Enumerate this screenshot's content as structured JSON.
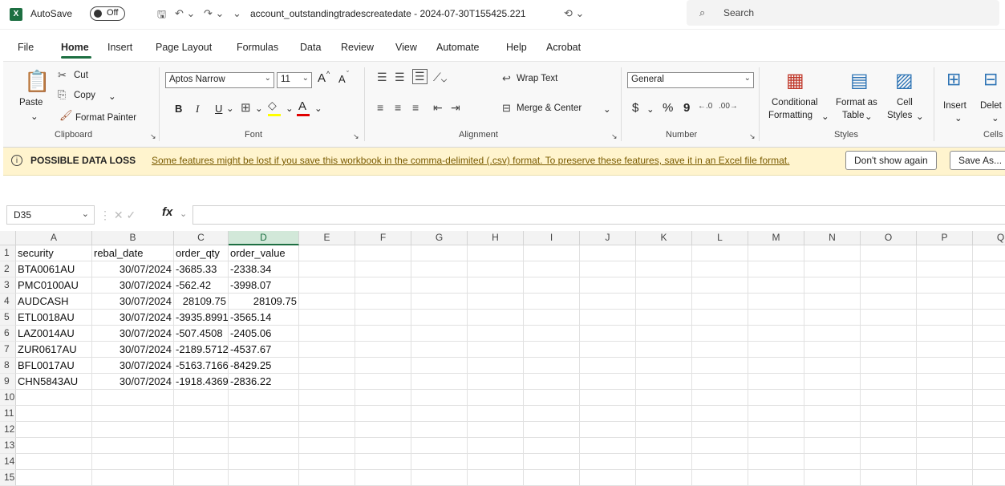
{
  "titlebar": {
    "app_logo": "X",
    "autosave_label": "AutoSave",
    "toggle_state": "Off",
    "filename": "account_outstandingtradescreatedate - 2024-07-30T155425.221",
    "search_placeholder": "Search"
  },
  "tabs": [
    "File",
    "Home",
    "Insert",
    "Page Layout",
    "Formulas",
    "Data",
    "Review",
    "View",
    "Automate",
    "Help",
    "Acrobat"
  ],
  "active_tab": "Home",
  "ribbon": {
    "clipboard": {
      "paste": "Paste",
      "cut": "Cut",
      "copy": "Copy",
      "format_painter": "Format Painter",
      "group": "Clipboard"
    },
    "font": {
      "name": "Aptos Narrow",
      "size": "11",
      "bold": "B",
      "italic": "I",
      "underline": "U",
      "group": "Font",
      "grow": "A",
      "shrink": "A",
      "fill": "A"
    },
    "alignment": {
      "wrap": "Wrap Text",
      "merge": "Merge & Center",
      "group": "Alignment"
    },
    "number": {
      "format": "General",
      "currency": "$",
      "percent": "%",
      "comma": "9",
      "group": "Number"
    },
    "styles": {
      "conditional_1": "Conditional",
      "conditional_2": "Formatting",
      "format_as_1": "Format as",
      "format_as_2": "Table",
      "cell_1": "Cell",
      "cell_2": "Styles",
      "group": "Styles"
    },
    "cells": {
      "insert": "Insert",
      "delete": "Delet",
      "group": "Cells"
    }
  },
  "message_bar": {
    "title": "POSSIBLE DATA LOSS",
    "text": "Some features might be lost if you save this workbook in the comma-delimited (.csv) format. To preserve these features, save it in an Excel file format.",
    "dont_show": "Don't show again",
    "save_as": "Save As..."
  },
  "formula_bar": {
    "name_box": "D35",
    "fx": "fx",
    "value": ""
  },
  "grid": {
    "columns": [
      "A",
      "B",
      "C",
      "D",
      "E",
      "F",
      "G",
      "H",
      "I",
      "J",
      "K",
      "L",
      "M",
      "N",
      "O",
      "P",
      "Q"
    ],
    "selected_column": "D",
    "row_numbers": [
      "1",
      "2",
      "3",
      "4",
      "5",
      "6",
      "7",
      "8",
      "9",
      "10",
      "11",
      "12",
      "13",
      "14",
      "15"
    ],
    "header_row": [
      "security",
      "rebal_date",
      "order_qty",
      "order_value"
    ],
    "rows": [
      [
        "BTA0061AU",
        "30/07/2024",
        "-3685.33",
        "-2338.34"
      ],
      [
        "PMC0100AU",
        "30/07/2024",
        "-562.42",
        "-3998.07"
      ],
      [
        "AUDCASH",
        "30/07/2024",
        "28109.75",
        "28109.75"
      ],
      [
        "ETL0018AU",
        "30/07/2024",
        "-3935.8991",
        "-3565.14"
      ],
      [
        "LAZ0014AU",
        "30/07/2024",
        "-507.4508",
        "-2405.06"
      ],
      [
        "ZUR0617AU",
        "30/07/2024",
        "-2189.5712",
        "-4537.67"
      ],
      [
        "BFL0017AU",
        "30/07/2024",
        "-5163.7166",
        "-8429.25"
      ],
      [
        "CHN5843AU",
        "30/07/2024",
        "-1918.4369",
        "-2836.22"
      ]
    ]
  }
}
